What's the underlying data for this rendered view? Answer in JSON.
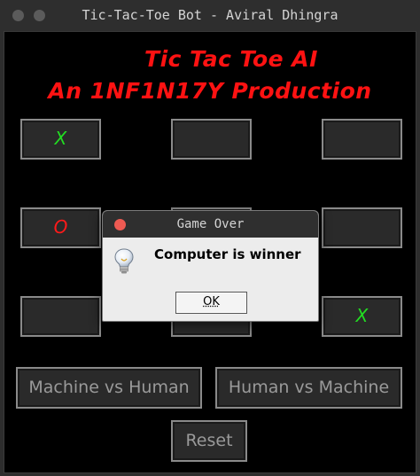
{
  "window": {
    "title": "Tic-Tac-Toe Bot - Aviral Dhingra"
  },
  "header": {
    "line1": "Tic Tac Toe AI",
    "line2": "An 1NF1N17Y Production"
  },
  "board": {
    "cells": [
      "X",
      "",
      "",
      "O",
      "",
      "",
      "",
      "",
      "X"
    ]
  },
  "controls": {
    "machine_vs_human": "Machine vs Human",
    "human_vs_machine": "Human vs Machine",
    "reset": "Reset"
  },
  "dialog": {
    "title": "Game Over",
    "message": "Computer is winner",
    "ok_label": "OK",
    "icon": "lightbulb-icon"
  },
  "colors": {
    "heading": "#ff1212",
    "x_mark": "#22dd22",
    "o_mark": "#ff1a1a",
    "button_text": "#9a9a9a"
  }
}
